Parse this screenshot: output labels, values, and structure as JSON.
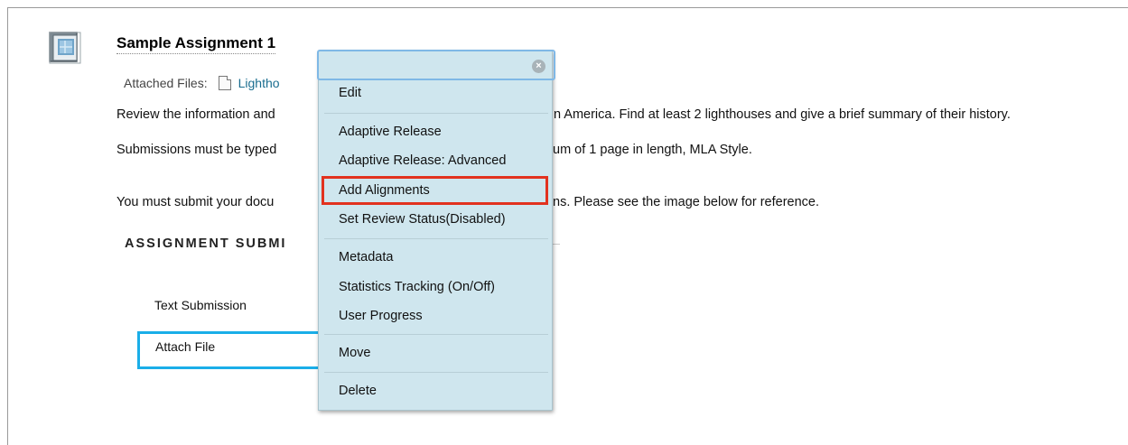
{
  "item": {
    "title": "Sample Assignment 1",
    "attached_label": "Attached Files:",
    "attached_file": "Lightho",
    "instructions": [
      {
        "left": "Review the information and",
        "right": "n America. Find at least 2 lighthouses and give a brief summary of their history."
      },
      {
        "left": "Submissions must be typed",
        "right": "um of 1 page in length, MLA Style."
      },
      {
        "left": "You must submit your docu",
        "right": "ns. Please see the image below for reference."
      }
    ]
  },
  "image_section": {
    "header": "ASSIGNMENT SUBMI",
    "options": [
      "Text Submission",
      "Attach File"
    ]
  },
  "context_menu": {
    "items": [
      "Edit",
      "Adaptive Release",
      "Adaptive Release: Advanced",
      "Add Alignments",
      "Set Review Status(Disabled)",
      "Metadata",
      "Statistics Tracking (On/Off)",
      "User Progress",
      "Move",
      "Delete"
    ],
    "highlighted_item": "Add Alignments"
  },
  "colors": {
    "menu_bg": "#cfe6ee",
    "highlight": "#e2321f",
    "attach_box": "#1aaee8",
    "link": "#1a6d8f"
  },
  "icons": [
    "assignment-icon",
    "file-icon",
    "close-icon"
  ]
}
